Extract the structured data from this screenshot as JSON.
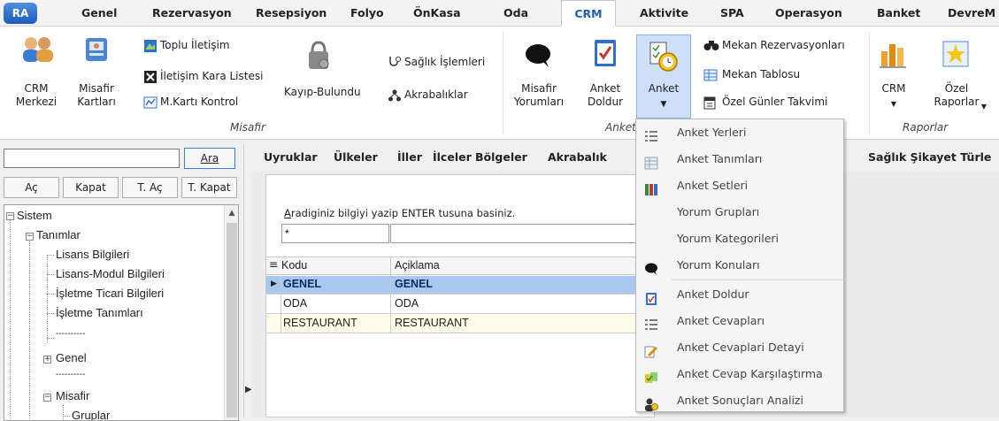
{
  "app_logo": "RA",
  "tabs": [
    {
      "label": "Genel"
    },
    {
      "label": "Rezervasyon"
    },
    {
      "label": "Resepsiyon"
    },
    {
      "label": "Folyo"
    },
    {
      "label": "ÖnKasa"
    },
    {
      "label": "Oda"
    },
    {
      "label": "CRM"
    },
    {
      "label": "Aktivite"
    },
    {
      "label": "SPA"
    },
    {
      "label": "Operasyon"
    },
    {
      "label": "Banket"
    },
    {
      "label": "DevreM"
    }
  ],
  "active_tab": "CRM",
  "ribbon": {
    "crm_merkezi": "CRM\nMerkezi",
    "misafir_kartlari": "Misafir\nKartları",
    "toplu_iletisim": "Toplu İletişim",
    "iletisim_kara_listesi": "İletişim Kara Listesi",
    "mkarti_kontrol": "M.Kartı Kontrol",
    "kayip_bulundu": "Kayıp-Bulundu",
    "saglik_islemleri": "Sağlık İşlemleri",
    "akrabaliklar": "Akrabalıklar",
    "misafir_yorumlari": "Misafir\nYorumları",
    "anket_doldur": "Anket\nDoldur",
    "anket": "Anket",
    "mekan_rezervasyonlari": "Mekan Rezervasyonları",
    "mekan_tablosu": "Mekan Tablosu",
    "ozel_gunler_takvimi": "Özel Günler Takvimi",
    "crm": "CRM",
    "ozel_raporlar": "Özel\nRaporlar",
    "group_misafir": "Misafir",
    "group_anket": "Anket",
    "group_raporlar": "Raporlar"
  },
  "left_panel": {
    "search_value": "",
    "ara": "Ara",
    "ac": "Aç",
    "kapat": "Kapat",
    "t_ac": "T. Aç",
    "t_kapat": "T. Kapat",
    "tree": [
      {
        "label": "Sistem",
        "expander": "−"
      },
      {
        "label": "Tanımlar",
        "expander": "−"
      },
      {
        "label": "Lisans Bilgileri"
      },
      {
        "label": "Lisans-Modul Bilgileri"
      },
      {
        "label": "İşletme Ticari Bilgileri"
      },
      {
        "label": "İşletme Tanımları"
      },
      {
        "label": "----------"
      },
      {
        "label": "Genel",
        "expander": "+"
      },
      {
        "label": "----------"
      },
      {
        "label": "Misafir",
        "expander": "−"
      },
      {
        "label": "Gruplar"
      }
    ]
  },
  "subtabs": [
    "Uyruklar",
    "Ülkeler",
    "İller",
    "İlceler",
    "Bölgeler",
    "Akrabalık"
  ],
  "subtab_right": "Sağlık Şikayet Türle",
  "content": {
    "hint": "Aradiginiz bilgiyi yazip ENTER tusuna basiniz.",
    "hint_underlined": "A",
    "filter_value": "*",
    "columns": [
      "Kodu",
      "Açiklama"
    ],
    "rows": [
      {
        "kodu": "GENEL",
        "aciklama": "GENEL"
      },
      {
        "kodu": "ODA",
        "aciklama": "ODA"
      },
      {
        "kodu": "RESTAURANT",
        "aciklama": "RESTAURANT"
      }
    ]
  },
  "dropdown": {
    "items": [
      {
        "label": "Anket Yerleri",
        "icon": "list-icon"
      },
      {
        "label": "Anket Tanımları",
        "icon": "grid-icon"
      },
      {
        "label": "Anket Setleri",
        "icon": "books-icon"
      },
      {
        "label": "Yorum Grupları",
        "icon": ""
      },
      {
        "label": "Yorum Kategorileri",
        "icon": ""
      },
      {
        "label": "Yorum Konuları",
        "icon": "speech-icon"
      },
      {
        "label": "Anket Doldur",
        "icon": "checklist-icon"
      },
      {
        "label": "Anket Cevapları",
        "icon": "list-icon"
      },
      {
        "label": "Anket Cevaplari Detayi",
        "icon": "edit-icon"
      },
      {
        "label": "Anket Cevap Karşılaştırma",
        "icon": "compare-icon"
      },
      {
        "label": "Anket Sonuçları Analizi",
        "icon": "analysis-icon"
      }
    ]
  },
  "colors": {
    "accent": "#1b5fae",
    "selected_row": "#a8c8f0",
    "alt_row": "#fffde7",
    "active_button": "#cde0f7"
  }
}
